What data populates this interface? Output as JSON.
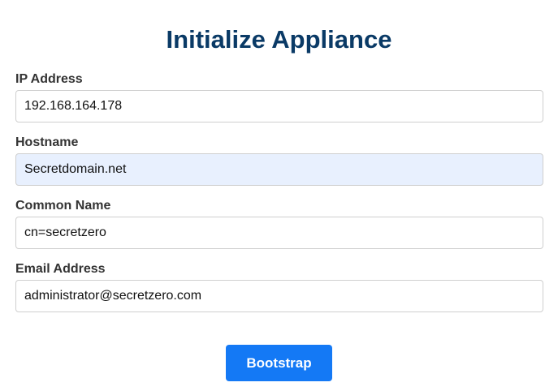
{
  "page": {
    "title": "Initialize Appliance"
  },
  "fields": {
    "ip_address": {
      "label": "IP Address",
      "value": "192.168.164.178"
    },
    "hostname": {
      "label": "Hostname",
      "value": "Secretdomain.net"
    },
    "common_name": {
      "label": "Common Name",
      "value": "cn=secretzero"
    },
    "email_address": {
      "label": "Email Address",
      "value": "administrator@secretzero.com"
    }
  },
  "actions": {
    "submit_label": "Bootstrap"
  },
  "colors": {
    "title": "#0a3a66",
    "button": "#1479f5",
    "autofill_background": "#e8f0fe"
  }
}
